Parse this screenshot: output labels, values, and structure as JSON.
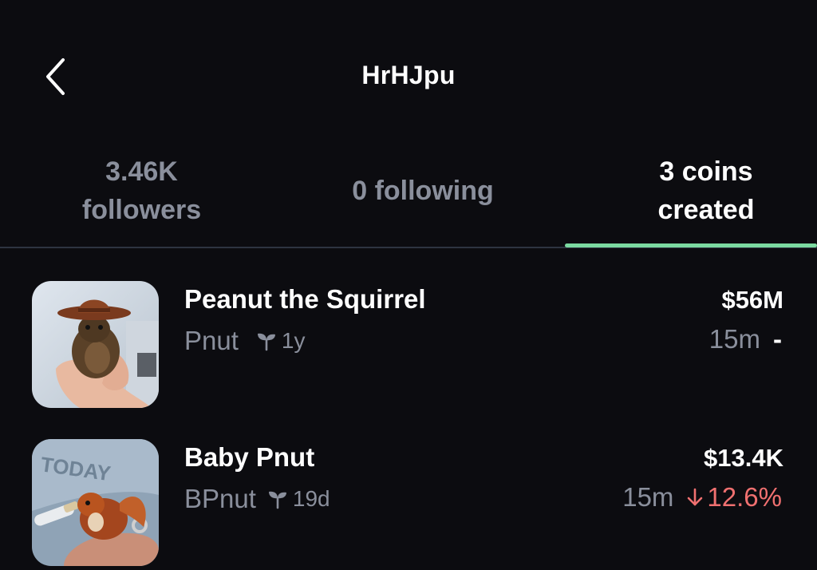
{
  "header": {
    "title": "HrHJpu",
    "back_icon": "chevron-left-icon"
  },
  "tabs": {
    "followers": {
      "line1": "3.46K",
      "line2": "followers"
    },
    "following": {
      "label": "0 following"
    },
    "coins": {
      "line1": "3 coins",
      "line2": "created"
    },
    "active_tab": "coins",
    "indicator_color": "#7bd9a0"
  },
  "coins": [
    {
      "name": "Peanut the Squirrel",
      "ticker": "Pnut",
      "age_icon": "sprout-icon",
      "age": "1y",
      "market_cap": "$56M",
      "period": "15m",
      "change": "-"
    },
    {
      "name": "Baby Pnut",
      "ticker": "BPnut",
      "age_icon": "sprout-icon",
      "age": "19d",
      "market_cap": "$13.4K",
      "period": "15m",
      "change_icon": "arrow-down-icon",
      "change": "12.6%",
      "change_color": "#f07070"
    }
  ]
}
